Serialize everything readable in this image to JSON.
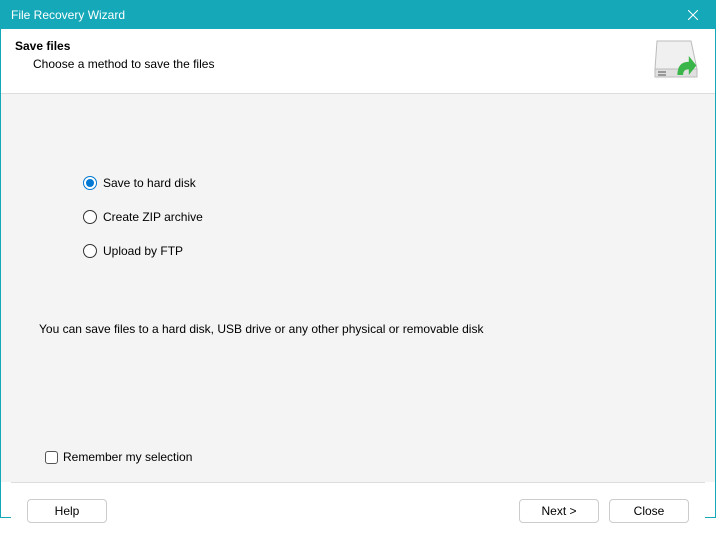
{
  "window": {
    "title": "File Recovery Wizard"
  },
  "header": {
    "title": "Save files",
    "subtitle": "Choose a method to save the files"
  },
  "options": {
    "hard_disk": "Save to hard disk",
    "zip": "Create ZIP archive",
    "ftp": "Upload by FTP",
    "selected": "hard_disk"
  },
  "description": "You can save files to a hard disk, USB drive or any other physical or removable disk",
  "remember": {
    "label": "Remember my selection",
    "checked": false
  },
  "buttons": {
    "help": "Help",
    "next": "Next >",
    "close": "Close"
  }
}
